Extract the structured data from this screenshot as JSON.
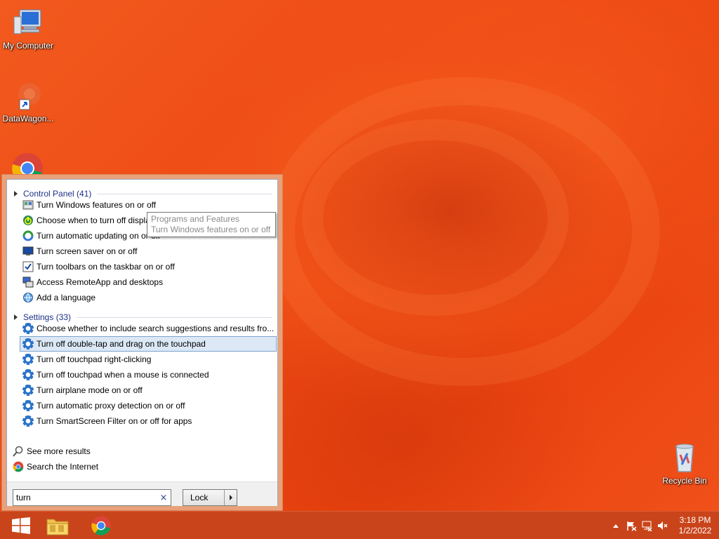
{
  "desktop": {
    "icons": [
      {
        "label": "My Computer"
      },
      {
        "label": "DataWagon..."
      },
      {
        "label": "Recycle Bin"
      }
    ]
  },
  "search_panel": {
    "groups": [
      {
        "header": "Control Panel (41)",
        "items": [
          {
            "label": "Turn Windows features on or off",
            "icon": "windows-features-icon"
          },
          {
            "label": "Choose when to turn off display",
            "icon": "power-options-icon"
          },
          {
            "label": "Turn automatic updating on or off",
            "icon": "windows-update-icon"
          },
          {
            "label": "Turn screen saver on or off",
            "icon": "screen-saver-icon"
          },
          {
            "label": "Turn toolbars on the taskbar on or off",
            "icon": "taskbar-icon"
          },
          {
            "label": "Access RemoteApp and desktops",
            "icon": "remoteapp-icon"
          },
          {
            "label": "Add a language",
            "icon": "language-icon"
          }
        ]
      },
      {
        "header": "Settings (33)",
        "items": [
          {
            "label": "Choose whether to include search suggestions and results fro...",
            "icon": "gear-icon"
          },
          {
            "label": "Turn off double-tap and drag on the touchpad",
            "icon": "gear-icon",
            "selected": true
          },
          {
            "label": "Turn off touchpad right-clicking",
            "icon": "gear-icon"
          },
          {
            "label": "Turn off touchpad when a mouse is connected",
            "icon": "gear-icon"
          },
          {
            "label": "Turn airplane mode on or off",
            "icon": "gear-icon"
          },
          {
            "label": "Turn automatic proxy detection on or off",
            "icon": "gear-icon"
          },
          {
            "label": "Turn SmartScreen Filter on or off for apps",
            "icon": "gear-icon"
          }
        ]
      }
    ],
    "see_more": "See more results",
    "search_internet": "Search the Internet",
    "search_value": "turn",
    "clear_glyph": "×",
    "lock_label": "Lock"
  },
  "tooltip": {
    "line1": "Programs and Features",
    "line2": "Turn Windows features on or off"
  },
  "taskbar": {
    "clock_time": "3:18 PM",
    "clock_date": "1/2/2022"
  },
  "colors": {
    "desktop_bg": "#f04a12",
    "taskbar_bg": "#c9441a",
    "link_blue": "#1e3287",
    "selection": "#dce8f6"
  }
}
